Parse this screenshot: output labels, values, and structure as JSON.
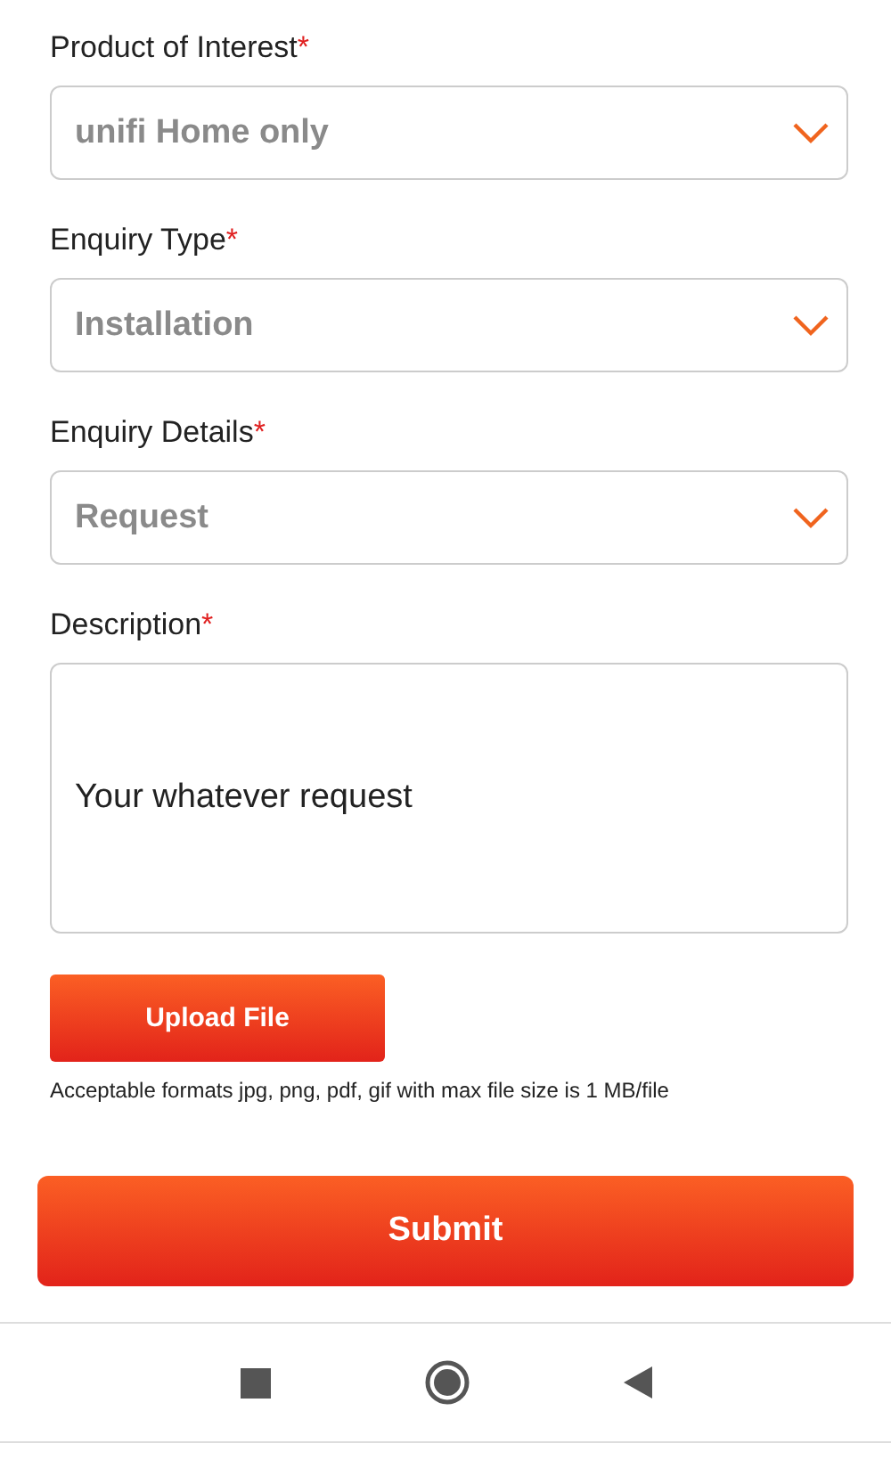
{
  "fields": [
    {
      "kind": "select",
      "label": "Product of Interest",
      "required_mark": "*",
      "value": "unifi Home only"
    },
    {
      "kind": "select",
      "label": "Enquiry Type",
      "required_mark": "*",
      "value": "Installation"
    },
    {
      "kind": "select",
      "label": "Enquiry Details",
      "required_mark": "*",
      "value": "Request"
    },
    {
      "kind": "textarea",
      "label": "Description",
      "required_mark": "*",
      "value": "Your whatever request"
    }
  ],
  "upload": {
    "button": "Upload File",
    "hint": "Acceptable formats jpg, png, pdf, gif with max file size is 1 MB/file"
  },
  "submit": "Submit"
}
